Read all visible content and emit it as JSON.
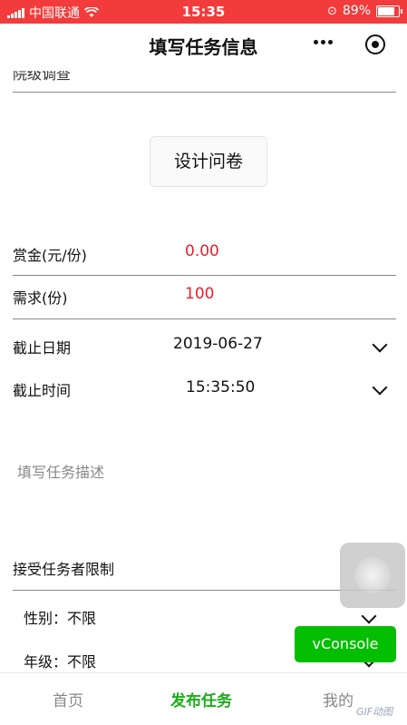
{
  "status_bar": {
    "carrier": "中国联通",
    "time": "15:35",
    "battery": "89%",
    "battery_level": 0.89
  },
  "nav": {
    "title": "填写任务信息"
  },
  "form": {
    "cutoff_text": "院级调查",
    "design_button": "设计问卷",
    "reward": {
      "label": "赏金(元/份)",
      "value": "0.00"
    },
    "quota": {
      "label": "需求(份)",
      "value": "100"
    },
    "deadline_date": {
      "label": "截止日期",
      "value": "2019-06-27"
    },
    "deadline_time": {
      "label": "截止时间",
      "value": "15:35:50"
    },
    "description_placeholder": "填写任务描述",
    "restriction": {
      "title": "接受任务者限制",
      "gender": {
        "label": "性别：",
        "value": "不限"
      },
      "grade": {
        "label": "年级：",
        "value": "不限"
      }
    }
  },
  "vconsole": {
    "label": "vConsole"
  },
  "tabbar": {
    "items": [
      {
        "label": "首页"
      },
      {
        "label": "发布任务"
      },
      {
        "label": "我的"
      }
    ],
    "active_color": "#1aad19",
    "inactive_color": "#888888"
  },
  "accent": {
    "red": "#e8202a",
    "status_bar": "#f23b3b",
    "vconsole": "#04be02"
  },
  "watermark": "GIF动图"
}
